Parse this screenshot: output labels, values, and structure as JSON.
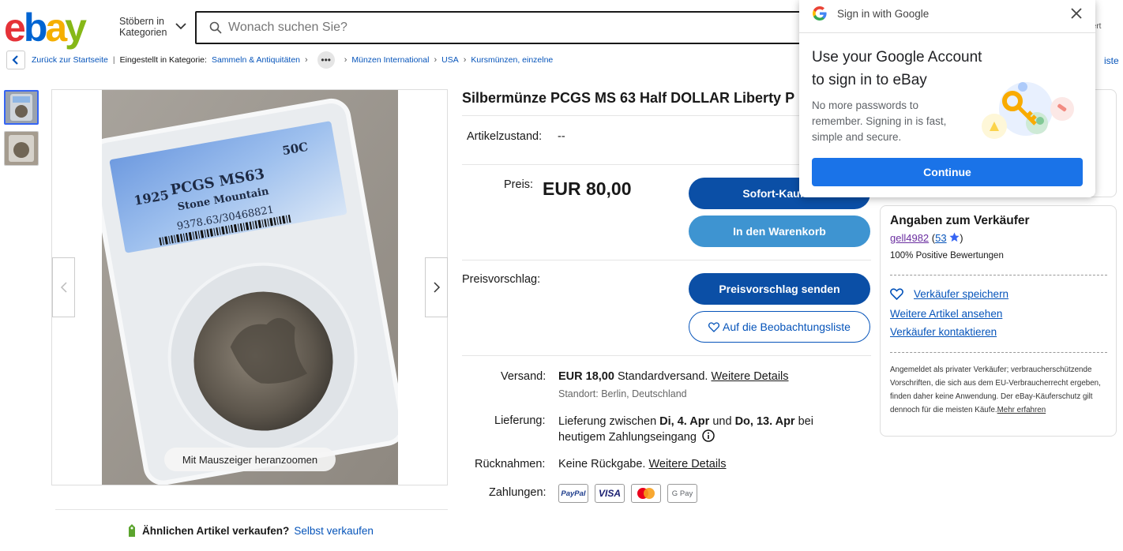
{
  "header": {
    "logo_letters": [
      "e",
      "b",
      "a",
      "y"
    ],
    "logo_colors": [
      "#e53238",
      "#0064d2",
      "#f5af02",
      "#86b817"
    ],
    "browse_line1": "Stöbern in",
    "browse_line2": "Kategorien",
    "search_placeholder": "Wonach suchen Sie?",
    "right_partial": "tert"
  },
  "breadcrumb": {
    "back": "Zurück zur Startseite",
    "listed_in": "Eingestellt in Kategorie:",
    "items": [
      "Sammeln & Antiquitäten",
      "Münzen International",
      "USA",
      "Kursmünzen, einzelne"
    ],
    "more": "•••",
    "right_link": "iste"
  },
  "gallery": {
    "zoom_hint": "Mit Mauszeiger heranzoomen",
    "slab_year": "1925",
    "slab_grade": "PCGS MS63",
    "slab_name": "Stone Mountain",
    "slab_denom": "50C",
    "slab_cert": "9378.63/30468821"
  },
  "sell": {
    "question": "Ähnlichen Artikel verkaufen?",
    "link": "Selbst verkaufen"
  },
  "item": {
    "title": "Silbermünze PCGS MS 63 Half DOLLAR Liberty P",
    "condition_label": "Artikelzustand:",
    "condition_value": "--",
    "price_label": "Preis:",
    "price": "EUR 80,00",
    "buy_now": "Sofort-Kaufen",
    "add_to_cart": "In den Warenkorb",
    "offer_label": "Preisvorschlag:",
    "send_offer": "Preisvorschlag senden",
    "watchlist": "Auf die Beobachtungsliste",
    "shipping_label": "Versand:",
    "shipping_price": "EUR 18,00",
    "shipping_type": "Standardversand.",
    "shipping_details": "Weitere Details",
    "location": "Standort: Berlin, Deutschland",
    "delivery_label": "Lieferung:",
    "delivery_pre": "Lieferung zwischen",
    "delivery_from": "Di, 4. Apr",
    "delivery_and": "und",
    "delivery_to": "Do, 13. Apr",
    "delivery_post": "bei",
    "delivery_line2": "heutigem Zahlungseingang",
    "returns_label": "Rücknahmen:",
    "returns_value": "Keine Rückgabe.",
    "returns_details": "Weitere Details",
    "payments_label": "Zahlungen:",
    "payments": [
      "PayPal",
      "VISA",
      "",
      "G Pay"
    ]
  },
  "seller": {
    "heading": "Angaben zum Verkäufer",
    "name": "gell4982",
    "rating_open": "(",
    "rating": "53",
    "rating_close": ")",
    "positive": "100% Positive Bewertungen",
    "save": "Verkäufer speichern",
    "more_items": "Weitere Artikel ansehen",
    "contact": "Verkäufer kontaktieren",
    "note": "Angemeldet als privater Verkäufer; verbraucherschützende Vorschriften, die sich aus dem EU-Verbraucherrecht ergeben, finden daher keine Anwendung. Der eBay-Käuferschutz gilt dennoch für die meisten Käufe.",
    "note_link": "Mehr erfahren"
  },
  "google_popup": {
    "title": "Sign in with Google",
    "heading_line1": "Use your Google Account",
    "heading_line2": "to sign in to eBay",
    "description": "No more passwords to remember. Signing in is fast, simple and secure.",
    "continue": "Continue"
  }
}
